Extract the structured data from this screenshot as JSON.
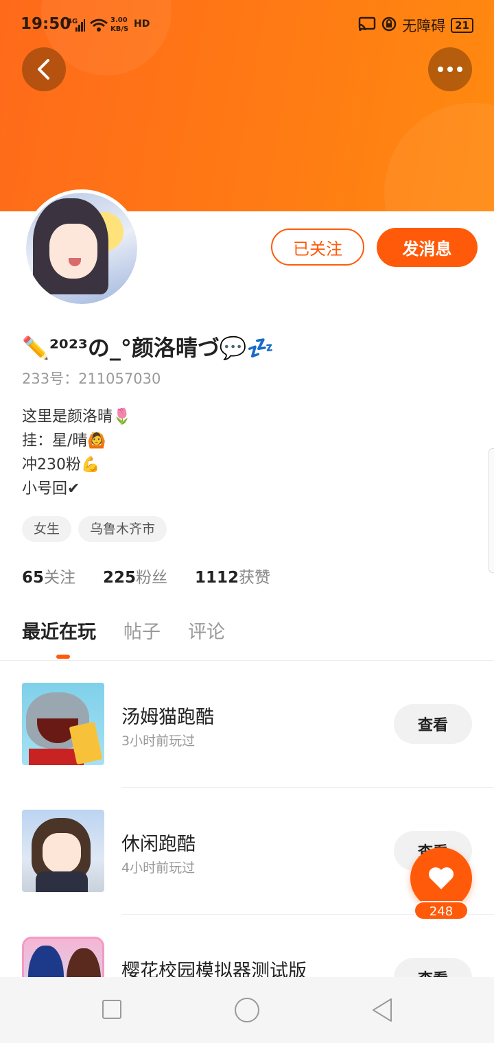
{
  "status_bar": {
    "time": "19:50",
    "network": "4G",
    "speed_value": "3.00",
    "speed_unit": "KB/S",
    "hd": "HD",
    "accessibility": "无障碍",
    "battery": "21"
  },
  "profile": {
    "followed_label": "已关注",
    "message_label": "发消息",
    "username": "✏️²⁰²³の_°颜洛晴づ💬💤",
    "uid": "233号：211057030",
    "bio": [
      "这里是颜洛晴🌷",
      "挂：星/晴🙆",
      "冲230粉💪",
      "小号回✔"
    ],
    "tags": [
      "女生",
      "乌鲁木齐市"
    ],
    "stats": [
      {
        "num": "65",
        "label": "关注"
      },
      {
        "num": "225",
        "label": "粉丝"
      },
      {
        "num": "1112",
        "label": "获赞"
      }
    ]
  },
  "tabs": [
    "最近在玩",
    "帖子",
    "评论"
  ],
  "games": [
    {
      "name": "汤姆猫跑酷",
      "time": "3小时前玩过",
      "action": "查看"
    },
    {
      "name": "休闲跑酷",
      "time": "4小时前玩过",
      "action": "查看"
    },
    {
      "name": "樱花校园模拟器测试版",
      "time": "",
      "action": "查看"
    }
  ],
  "floating": {
    "count": "248"
  },
  "colors": {
    "brand": "#ff5a0a",
    "header": "#ff7a14"
  }
}
